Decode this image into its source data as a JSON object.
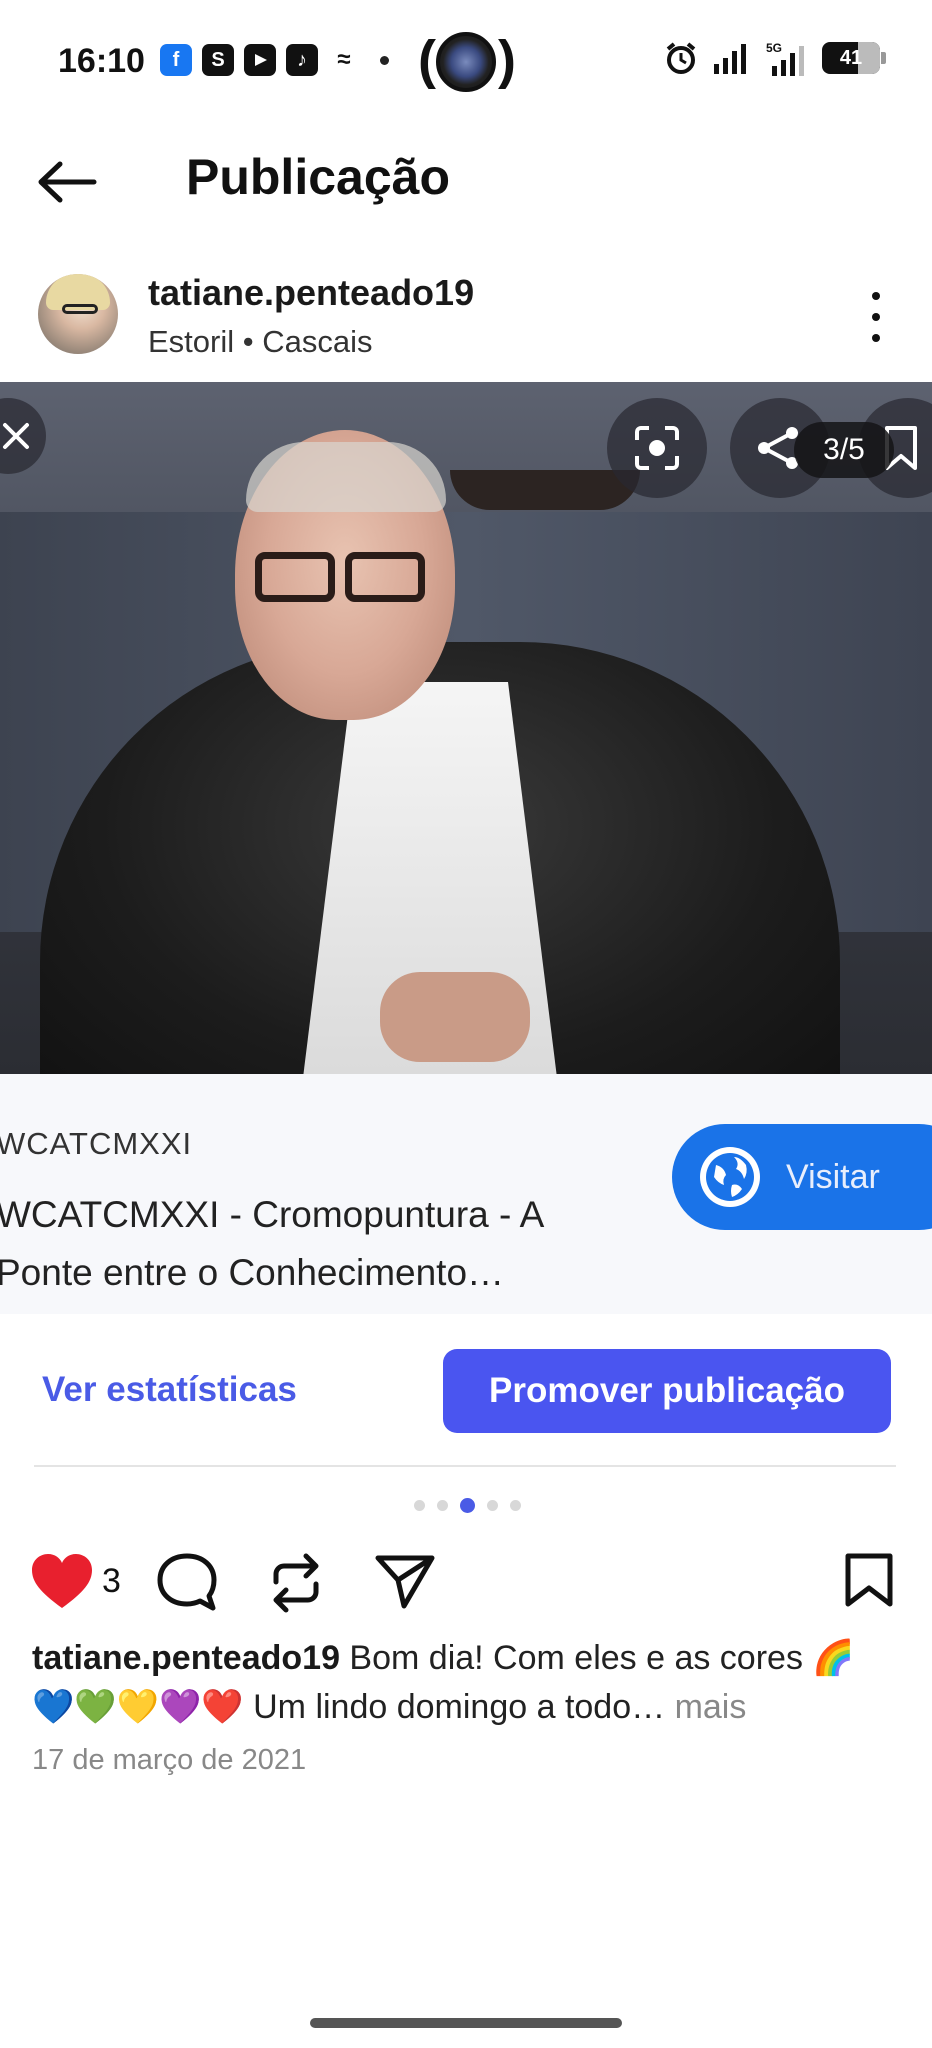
{
  "status_bar": {
    "time": "16:10",
    "app_icons": [
      "facebook-icon",
      "s-app-icon",
      "youtube-icon",
      "tiktok-icon",
      "z-app-icon"
    ],
    "network": "5G",
    "battery": "41"
  },
  "header": {
    "title": "Publicação"
  },
  "post": {
    "username": "tatiane.penteado19",
    "location": "Estoril • Cascais",
    "media_counter": "3/5",
    "current_slide": 3,
    "total_slides": 5
  },
  "link_preview": {
    "domain": "WCATCMXXI",
    "title": "WCATCMXXI - Cromopuntura - A Ponte entre o Conhecimento…",
    "visit_label": "Visitar"
  },
  "actions": {
    "stats_label": "Ver estatísticas",
    "promote_label": "Promover publicação",
    "like_count": "3"
  },
  "caption": {
    "username": "tatiane.penteado19",
    "text": " Bom dia! Com eles e as cores 🌈💙💚💛💜❤️ Um lindo domingo a todo…",
    "more": " mais",
    "date": "17 de março de 2021"
  },
  "colors": {
    "accent": "#4a55f0",
    "link_blue": "#4a5be6",
    "visit_blue": "#1a73e8",
    "like_red": "#e8202e"
  }
}
